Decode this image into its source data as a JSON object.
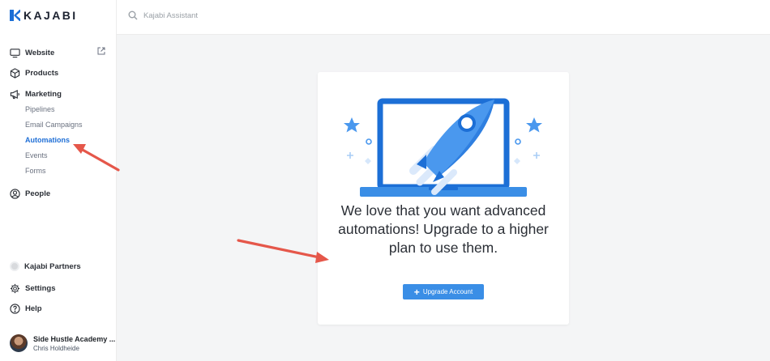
{
  "brand": {
    "name": "KAJABI",
    "color": "#1c6fd6"
  },
  "search": {
    "placeholder": "Kajabi Assistant"
  },
  "sidebar": {
    "items": [
      {
        "label": "Website",
        "icon": "monitor-icon"
      },
      {
        "label": "Products",
        "icon": "box-icon"
      },
      {
        "label": "Marketing",
        "icon": "megaphone-icon"
      },
      {
        "label": "People",
        "icon": "user-circle-icon"
      }
    ],
    "marketing_subitems": [
      {
        "label": "Pipelines",
        "active": false
      },
      {
        "label": "Email Campaigns",
        "active": false
      },
      {
        "label": "Automations",
        "active": true
      },
      {
        "label": "Events",
        "active": false
      },
      {
        "label": "Forms",
        "active": false
      }
    ],
    "bottom_items": [
      {
        "label": "Kajabi Partners",
        "icon": "partners-icon"
      },
      {
        "label": "Settings",
        "icon": "gear-icon"
      },
      {
        "label": "Help",
        "icon": "help-circle-icon"
      }
    ],
    "account": {
      "name": "Side Hustle Academy ...",
      "user": "Chris Holdheide"
    }
  },
  "upsell": {
    "headline": "We love that you want advanced automations! Upgrade to a higher plan to use them.",
    "button_label": "Upgrade Account",
    "button_color": "#3a8ee6"
  },
  "annotation_color": "#e5574a"
}
